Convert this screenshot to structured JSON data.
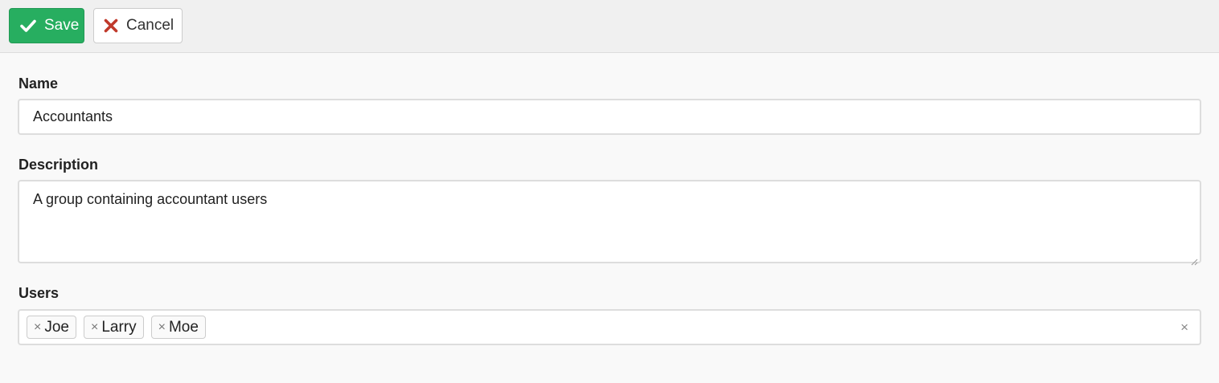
{
  "toolbar": {
    "save_label": "Save",
    "cancel_label": "Cancel",
    "save_icon": "checkmark-icon",
    "cancel_icon": "x-icon",
    "save_color": "#27ae60",
    "cancel_icon_color": "#c0392b"
  },
  "form": {
    "name_label": "Name",
    "name_value": "Accountants",
    "description_label": "Description",
    "description_value": "A group containing accountant users",
    "users_label": "Users",
    "users": [
      "Joe",
      "Larry",
      "Moe"
    ],
    "tag_remove_glyph": "×",
    "clear_glyph": "×"
  }
}
